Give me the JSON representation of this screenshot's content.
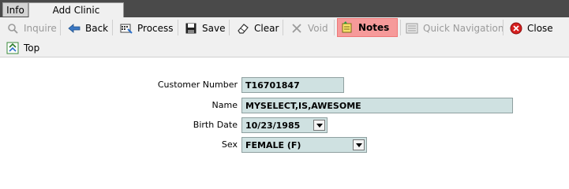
{
  "tabs": [
    {
      "label": "Info"
    },
    {
      "label": "Add Clinic Completion"
    }
  ],
  "toolbar": {
    "inquire": "Inquire",
    "back": "Back",
    "process": "Process",
    "save": "Save",
    "clear": "Clear",
    "void": "Void",
    "notes": "Notes",
    "quick_navigation": "Quick Navigation",
    "close": "Close",
    "top": "Top"
  },
  "form": {
    "customer_number_label": "Customer Number",
    "customer_number": "T16701847",
    "name_label": "Name",
    "name": "MYSELECT,IS,AWESOME",
    "birth_date_label": "Birth Date",
    "birth_date": "10/23/1985",
    "sex_label": "Sex",
    "sex": "FEMALE (F)"
  },
  "colors": {
    "field_bg": "#cfe1e1",
    "notes_bg": "#f69a9a",
    "tabstrip_bg": "#4a4a4a"
  },
  "icons": [
    "search-icon",
    "back-arrow-icon",
    "process-icon",
    "save-disk-icon",
    "eraser-icon",
    "void-x-icon",
    "notes-icon",
    "quick-navigation-icon",
    "close-icon",
    "top-icon",
    "dropdown-arrow-icon"
  ]
}
